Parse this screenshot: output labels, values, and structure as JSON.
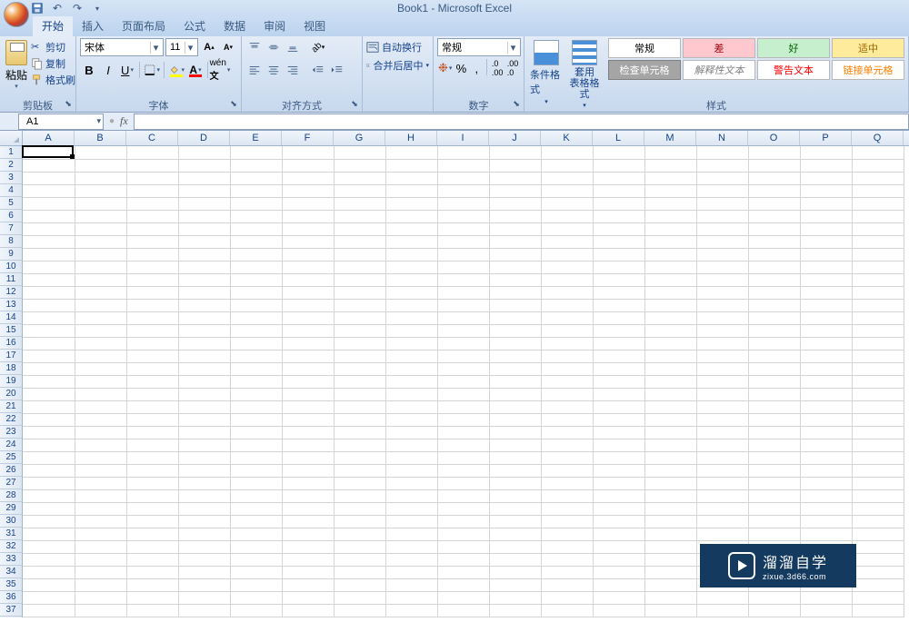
{
  "title": "Book1 - Microsoft Excel",
  "tabs": [
    "开始",
    "插入",
    "页面布局",
    "公式",
    "数据",
    "审阅",
    "视图"
  ],
  "active_tab": 0,
  "clipboard": {
    "paste": "粘贴",
    "cut": "剪切",
    "copy": "复制",
    "format_painter": "格式刷",
    "label": "剪贴板"
  },
  "font": {
    "name": "宋体",
    "size": "11",
    "label": "字体",
    "bold": "B",
    "italic": "I",
    "underline": "U"
  },
  "alignment": {
    "wrap": "自动换行",
    "merge": "合并后居中",
    "label": "对齐方式"
  },
  "number": {
    "format": "常规",
    "label": "数字"
  },
  "styles": {
    "conditional": "条件格式",
    "table": "套用\n表格格式",
    "label": "样式",
    "gallery": [
      {
        "text": "常规",
        "bg": "#ffffff",
        "fg": "#000000",
        "border": "#b8b8b8"
      },
      {
        "text": "差",
        "bg": "#ffc7ce",
        "fg": "#9c0006",
        "border": "#b8b8b8"
      },
      {
        "text": "好",
        "bg": "#c6efce",
        "fg": "#006100",
        "border": "#b8b8b8"
      },
      {
        "text": "适中",
        "bg": "#ffeb9c",
        "fg": "#9c6500",
        "border": "#b8b8b8"
      },
      {
        "text": "检查单元格",
        "bg": "#a5a5a5",
        "fg": "#ffffff",
        "border": "#808080"
      },
      {
        "text": "解释性文本",
        "bg": "#ffffff",
        "fg": "#808080",
        "border": "#b8b8b8",
        "italic": true
      },
      {
        "text": "警告文本",
        "bg": "#ffffff",
        "fg": "#ff0000",
        "border": "#b8b8b8"
      },
      {
        "text": "链接单元格",
        "bg": "#ffffff",
        "fg": "#ff8000",
        "border": "#b8b8b8"
      }
    ]
  },
  "name_box": "A1",
  "columns": [
    "A",
    "B",
    "C",
    "D",
    "E",
    "F",
    "G",
    "H",
    "I",
    "J",
    "K",
    "L",
    "M",
    "N",
    "O",
    "P",
    "Q"
  ],
  "row_count": 37,
  "active_cell": {
    "row": 0,
    "col": 0
  },
  "watermark": {
    "main": "溜溜自学",
    "sub": "zixue.3d66.com"
  }
}
